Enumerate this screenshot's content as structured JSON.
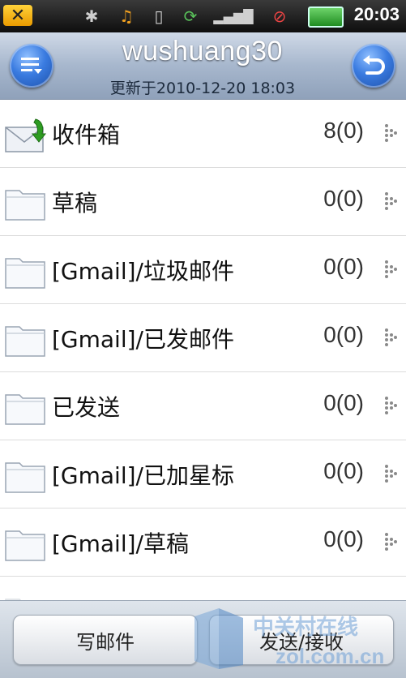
{
  "status_bar": {
    "time": "20:03",
    "icons": [
      "mail-notification-icon",
      "bluetooth-icon",
      "music-icon",
      "vibrate-icon",
      "sync-icon",
      "signal-3g-icon",
      "alarm-icon",
      "battery-icon"
    ]
  },
  "header": {
    "title": "wushuang30",
    "subtitle": "更新于2010-12-20 18:03",
    "left_button_icon": "menu-icon",
    "right_button_icon": "back-icon"
  },
  "folders": [
    {
      "label": "收件箱",
      "count": "8(0)",
      "icon": "inbox-envelope-icon"
    },
    {
      "label": "草稿",
      "count": "0(0)",
      "icon": "folder-icon"
    },
    {
      "label": "[Gmail]/垃圾邮件",
      "count": "0(0)",
      "icon": "folder-icon"
    },
    {
      "label": "[Gmail]/已发邮件",
      "count": "0(0)",
      "icon": "folder-icon"
    },
    {
      "label": "已发送",
      "count": "0(0)",
      "icon": "folder-icon"
    },
    {
      "label": "[Gmail]/已加星标",
      "count": "0(0)",
      "icon": "folder-icon"
    },
    {
      "label": "[Gmail]/草稿",
      "count": "0(0)",
      "icon": "folder-icon"
    }
  ],
  "bottom": {
    "compose_label": "写邮件",
    "send_receive_label": "发送/接收"
  },
  "watermark": {
    "text_cn": "中关村在线",
    "text_en": "zol.com.cn"
  },
  "colors": {
    "header_bg": "#a7b7cd",
    "round_button": "#3a7be0",
    "accent_green": "#2e9c22"
  }
}
